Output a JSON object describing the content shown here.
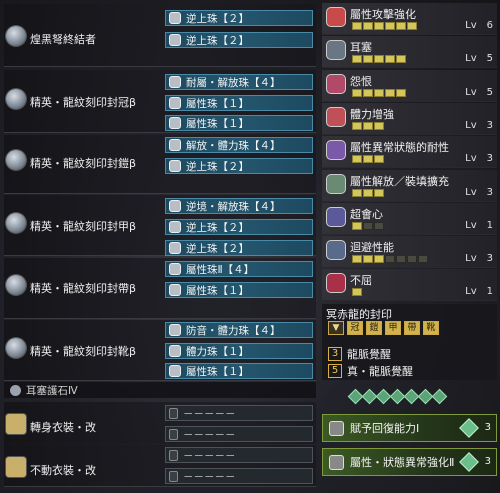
{
  "equipment": [
    {
      "name": "煌黑弩終結者",
      "icon": "weapon-icon",
      "slots": [
        "逆上珠【２】",
        "逆上珠【２】"
      ]
    },
    {
      "name": "精英・龍紋刻印封冠β",
      "icon": "helm-icon",
      "slots": [
        "耐屬・解放珠【４】",
        "屬性珠【１】",
        "屬性珠【１】"
      ]
    },
    {
      "name": "精英・龍紋刻印封鎧β",
      "icon": "chest-icon",
      "slots": [
        "解放・體力珠【４】",
        "逆上珠【２】"
      ]
    },
    {
      "name": "精英・龍紋刻印封甲β",
      "icon": "arms-icon",
      "slots": [
        "逆境・解放珠【４】",
        "逆上珠【２】",
        "逆上珠【２】"
      ]
    },
    {
      "name": "精英・龍紋刻印封帶β",
      "icon": "waist-icon",
      "slots": [
        "屬性珠Ⅱ【４】",
        "屬性珠【１】"
      ]
    },
    {
      "name": "精英・龍紋刻印封靴β",
      "icon": "legs-icon",
      "slots": [
        "防音・體力珠【４】",
        "體力珠【１】",
        "屬性珠【１】"
      ]
    }
  ],
  "charm": {
    "name": "耳塞護石Ⅳ"
  },
  "mantles": [
    {
      "name": "轉身衣裝・改",
      "slots": [
        "－－－－－",
        "－－－－－"
      ]
    },
    {
      "name": "不動衣裝・改",
      "slots": [
        "－－－－－",
        "－－－－－"
      ]
    }
  ],
  "skills": [
    {
      "name": "屬性攻擊強化",
      "lv": "Lv",
      "level": "6",
      "max": 6,
      "color": "#c84a4a"
    },
    {
      "name": "耳塞",
      "lv": "Lv",
      "level": "5",
      "max": 5,
      "color": "#6b7684"
    },
    {
      "name": "怨恨",
      "lv": "Lv",
      "level": "5",
      "max": 5,
      "color": "#b04a68"
    },
    {
      "name": "體力增強",
      "lv": "Lv",
      "level": "3",
      "max": 3,
      "color": "#c05058"
    },
    {
      "name": "屬性異常狀態的耐性",
      "lv": "Lv",
      "level": "3",
      "max": 3,
      "color": "#7a5aa8"
    },
    {
      "name": "屬性解放／裝填擴充",
      "lv": "Lv",
      "level": "3",
      "max": 3,
      "color": "#6a8a74"
    },
    {
      "name": "超會心",
      "lv": "Lv",
      "level": "1",
      "max": 3,
      "color": "#5a5a9a"
    },
    {
      "name": "迴避性能",
      "lv": "Lv",
      "level": "3",
      "max": 7,
      "color": "#5a6a8a"
    },
    {
      "name": "不屈",
      "lv": "Lv",
      "level": "1",
      "max": 1,
      "color": "#a83048"
    }
  ],
  "set_skill": {
    "title": "冥赤龍的封印",
    "pieces": [
      "冠",
      "鎧",
      "甲",
      "帶",
      "靴"
    ],
    "bonuses": [
      {
        "count": "3",
        "name": "龍脈覺醒"
      },
      {
        "count": "5",
        "name": "真・龍脈覺醒"
      }
    ]
  },
  "bonus_bars": [
    {
      "name": "賦予回復能力Ⅰ",
      "count": "3",
      "color": "#6bbd8a"
    },
    {
      "name": "屬性・狀態異常強化Ⅱ",
      "count": "3",
      "color": "#6bbd8a"
    }
  ],
  "colors": {
    "slot_bg": "#24566e",
    "slot_border": "#4a8aa6",
    "pip_on": "#d4c658",
    "gold": "#d2b24a"
  }
}
